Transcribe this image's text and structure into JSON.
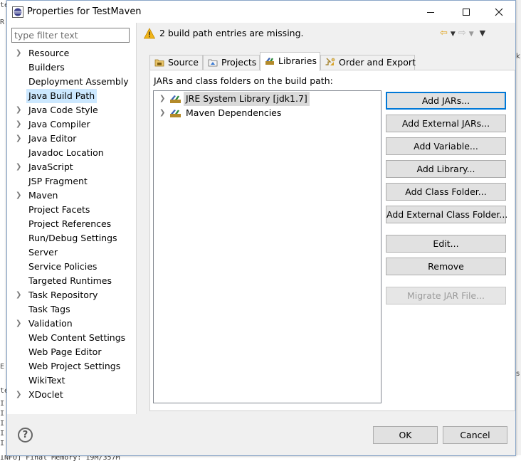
{
  "window": {
    "title": "Properties for TestMaven"
  },
  "filter": {
    "placeholder": "type filter text"
  },
  "nav": [
    {
      "label": "Resource",
      "expandable": true
    },
    {
      "label": "Builders",
      "expandable": false
    },
    {
      "label": "Deployment Assembly",
      "expandable": false
    },
    {
      "label": "Java Build Path",
      "expandable": false,
      "selected": true
    },
    {
      "label": "Java Code Style",
      "expandable": true
    },
    {
      "label": "Java Compiler",
      "expandable": true
    },
    {
      "label": "Java Editor",
      "expandable": true
    },
    {
      "label": "Javadoc Location",
      "expandable": false
    },
    {
      "label": "JavaScript",
      "expandable": true
    },
    {
      "label": "JSP Fragment",
      "expandable": false
    },
    {
      "label": "Maven",
      "expandable": true
    },
    {
      "label": "Project Facets",
      "expandable": false
    },
    {
      "label": "Project References",
      "expandable": false
    },
    {
      "label": "Run/Debug Settings",
      "expandable": false
    },
    {
      "label": "Server",
      "expandable": false
    },
    {
      "label": "Service Policies",
      "expandable": false
    },
    {
      "label": "Targeted Runtimes",
      "expandable": false
    },
    {
      "label": "Task Repository",
      "expandable": true
    },
    {
      "label": "Task Tags",
      "expandable": false
    },
    {
      "label": "Validation",
      "expandable": true
    },
    {
      "label": "Web Content Settings",
      "expandable": false
    },
    {
      "label": "Web Page Editor",
      "expandable": false
    },
    {
      "label": "Web Project Settings",
      "expandable": false
    },
    {
      "label": "WikiText",
      "expandable": false
    },
    {
      "label": "XDoclet",
      "expandable": true
    }
  ],
  "message": {
    "text": "2 build path entries are missing."
  },
  "tabs": [
    {
      "label": "Source",
      "icon": "source-folder-icon"
    },
    {
      "label": "Projects",
      "icon": "projects-icon"
    },
    {
      "label": "Libraries",
      "icon": "libraries-icon",
      "active": true
    },
    {
      "label": "Order and Export",
      "icon": "order-export-icon"
    }
  ],
  "libraries": {
    "heading": "JARs and class folders on the build path:",
    "entries": [
      {
        "label": "JRE System Library [jdk1.7]",
        "selected": true
      },
      {
        "label": "Maven Dependencies",
        "selected": false
      }
    ]
  },
  "buttons": [
    {
      "label": "Add JARs...",
      "default": true
    },
    {
      "label": "Add External JARs..."
    },
    {
      "label": "Add Variable..."
    },
    {
      "label": "Add Library..."
    },
    {
      "label": "Add Class Folder..."
    },
    {
      "label": "Add External Class Folder..."
    },
    {
      "label": "Edit..."
    },
    {
      "label": "Remove"
    },
    {
      "label": "Migrate JAR File...",
      "disabled": true
    }
  ],
  "footer": {
    "ok_label": "OK",
    "cancel_label": "Cancel"
  },
  "background": {
    "console_line": "INFO] Final Memory: 19M/357M",
    "left_fragments": [
      "te",
      "R",
      "E",
      "te",
      "I",
      "I",
      "I",
      "I",
      "I"
    ],
    "right_fragments": [
      "k",
      "s"
    ]
  },
  "colors": {
    "selection": "#cce8ff",
    "default_button_border": "#0078d7",
    "warning": "#f2b518"
  }
}
